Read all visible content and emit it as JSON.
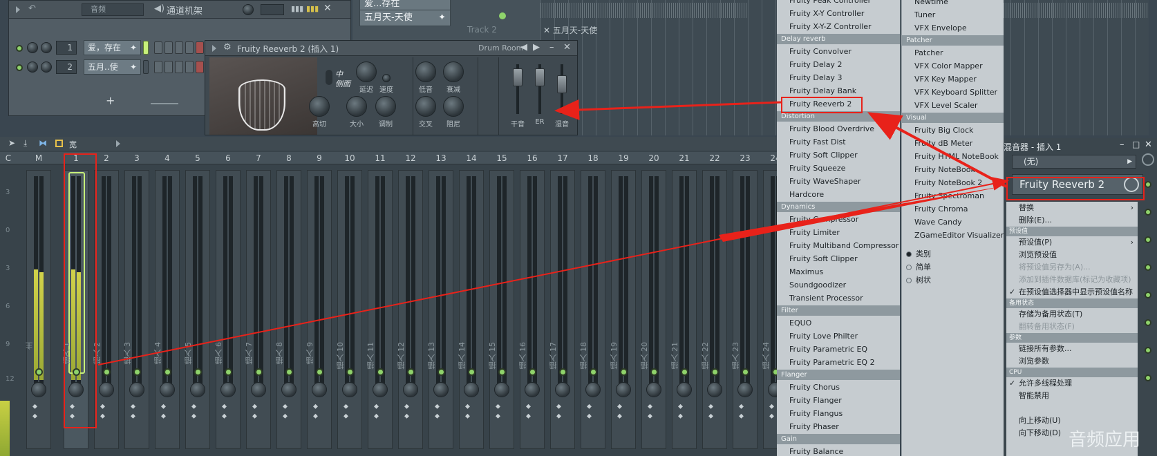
{
  "channel_rack": {
    "group_label": "音频",
    "title": "通道机架",
    "add_label": "+",
    "channels": [
      {
        "number": "1",
        "name": "爱，存在"
      },
      {
        "number": "2",
        "name": "五月..使"
      }
    ]
  },
  "reverb_window": {
    "title": "Fruity Reeverb 2 (插入 1)",
    "preset": "Drum Room",
    "mode_label_top": "中",
    "mode_label_bottom": "侧面",
    "knobs": [
      "延迟",
      "速度",
      "低音",
      "衰减",
      "高切",
      "大小",
      "调制",
      "交叉",
      "阻尼"
    ],
    "faders": [
      "干音",
      "ER",
      "湿音"
    ]
  },
  "playlist": {
    "clips": [
      "爱...存在",
      "五月天-天使"
    ],
    "track_label": "Track 2",
    "clip_label": "五月天-天使"
  },
  "mixer": {
    "toolbar_label": "宽",
    "columns": [
      "C",
      "M",
      "1",
      "2",
      "3",
      "4",
      "5",
      "6",
      "7",
      "8",
      "9",
      "10",
      "11",
      "12",
      "13",
      "14",
      "15",
      "16",
      "17",
      "18",
      "19",
      "20",
      "21",
      "22",
      "23",
      "24"
    ],
    "master_label": "主",
    "strip_prefix": "插入",
    "scale": [
      "3",
      "0",
      "3",
      "6",
      "9",
      "12"
    ]
  },
  "plugin_menu_left": {
    "items": [
      {
        "type": "item",
        "label": "Fruity Peak Controller"
      },
      {
        "type": "item",
        "label": "Fruity X-Y Controller"
      },
      {
        "type": "item",
        "label": "Fruity X-Y-Z Controller"
      },
      {
        "type": "header",
        "label": "Delay reverb"
      },
      {
        "type": "item",
        "label": "Fruity Convolver"
      },
      {
        "type": "item",
        "label": "Fruity Delay 2"
      },
      {
        "type": "item",
        "label": "Fruity Delay 3"
      },
      {
        "type": "item",
        "label": "Fruity Delay Bank"
      },
      {
        "type": "item",
        "label": "Fruity Reeverb 2"
      },
      {
        "type": "header",
        "label": "Distortion"
      },
      {
        "type": "item",
        "label": "Fruity Blood Overdrive"
      },
      {
        "type": "item",
        "label": "Fruity Fast Dist"
      },
      {
        "type": "item",
        "label": "Fruity Soft Clipper"
      },
      {
        "type": "item",
        "label": "Fruity Squeeze"
      },
      {
        "type": "item",
        "label": "Fruity WaveShaper"
      },
      {
        "type": "item",
        "label": "Hardcore"
      },
      {
        "type": "header",
        "label": "Dynamics"
      },
      {
        "type": "item",
        "label": "Fruity Compressor"
      },
      {
        "type": "item",
        "label": "Fruity Limiter"
      },
      {
        "type": "item",
        "label": "Fruity Multiband Compressor"
      },
      {
        "type": "item",
        "label": "Fruity Soft Clipper"
      },
      {
        "type": "item",
        "label": "Maximus"
      },
      {
        "type": "item",
        "label": "Soundgoodizer"
      },
      {
        "type": "item",
        "label": "Transient Processor"
      },
      {
        "type": "header",
        "label": "Filter"
      },
      {
        "type": "item",
        "label": "EQUO"
      },
      {
        "type": "item",
        "label": "Fruity Love Philter"
      },
      {
        "type": "item",
        "label": "Fruity Parametric EQ"
      },
      {
        "type": "item",
        "label": "Fruity Parametric EQ 2"
      },
      {
        "type": "header",
        "label": "Flanger"
      },
      {
        "type": "item",
        "label": "Fruity Chorus"
      },
      {
        "type": "item",
        "label": "Fruity Flanger"
      },
      {
        "type": "item",
        "label": "Fruity Flangus"
      },
      {
        "type": "item",
        "label": "Fruity Phaser"
      },
      {
        "type": "header",
        "label": "Gain"
      },
      {
        "type": "item",
        "label": "Fruity Balance"
      }
    ]
  },
  "plugin_menu_right": {
    "items": [
      {
        "type": "item",
        "label": "Newtime"
      },
      {
        "type": "item",
        "label": "Tuner"
      },
      {
        "type": "item",
        "label": "VFX Envelope"
      },
      {
        "type": "header",
        "label": "Patcher"
      },
      {
        "type": "item",
        "label": "Patcher"
      },
      {
        "type": "item",
        "label": "VFX Color Mapper"
      },
      {
        "type": "item",
        "label": "VFX Key Mapper"
      },
      {
        "type": "item",
        "label": "VFX Keyboard Splitter"
      },
      {
        "type": "item",
        "label": "VFX Level Scaler"
      },
      {
        "type": "header",
        "label": "Visual"
      },
      {
        "type": "item",
        "label": "Fruity Big Clock"
      },
      {
        "type": "item",
        "label": "Fruity dB Meter"
      },
      {
        "type": "item",
        "label": "Fruity HTML NoteBook"
      },
      {
        "type": "item",
        "label": "Fruity NoteBook"
      },
      {
        "type": "item",
        "label": "Fruity NoteBook 2"
      },
      {
        "type": "item",
        "label": "Fruity Spectroman"
      },
      {
        "type": "item",
        "label": "Fruity Chroma"
      },
      {
        "type": "item",
        "label": "Wave Candy"
      },
      {
        "type": "item",
        "label": "ZGameEditor Visualizer"
      }
    ],
    "view_options": [
      {
        "label": "类别",
        "selected": true
      },
      {
        "label": "简单",
        "selected": false
      },
      {
        "label": "树状",
        "selected": false
      }
    ]
  },
  "insert_panel": {
    "title": "混音器 - 插入 1",
    "dropdown": "(无)",
    "slot_plugin": "Fruity Reeverb 2"
  },
  "context_menu": {
    "items": [
      {
        "type": "item",
        "label": "替换",
        "submenu": true
      },
      {
        "type": "item",
        "label": "删除(E)..."
      },
      {
        "type": "header",
        "label": "预设值"
      },
      {
        "type": "item",
        "label": "预设值(P)",
        "submenu": true
      },
      {
        "type": "item",
        "label": "浏览预设值"
      },
      {
        "type": "item",
        "label": "将预设值另存为(A)...",
        "disabled": true
      },
      {
        "type": "item",
        "label": "添加到插件数据库(标记为收藏项)",
        "disabled": true
      },
      {
        "type": "item",
        "label": "在预设值选择器中显示预设值名称",
        "checked": true
      },
      {
        "type": "header",
        "label": "备用状态"
      },
      {
        "type": "item",
        "label": "存储为备用状态(T)"
      },
      {
        "type": "item",
        "label": "翻转备用状态(F)",
        "disabled": true
      },
      {
        "type": "header",
        "label": "参数"
      },
      {
        "type": "item",
        "label": "链接所有参数..."
      },
      {
        "type": "item",
        "label": "浏览参数"
      },
      {
        "type": "header",
        "label": "CPU"
      },
      {
        "type": "item",
        "label": "允许多线程处理",
        "checked": true
      },
      {
        "type": "item",
        "label": "智能禁用"
      },
      {
        "type": "item",
        "label": ""
      },
      {
        "type": "item",
        "label": "向上移动(U)"
      },
      {
        "type": "item",
        "label": "向下移动(D)"
      }
    ]
  },
  "watermark": "音频应用",
  "colors": {
    "annotation": "#e8221a",
    "led_green": "#8fd36b",
    "meter": "#c8d044"
  }
}
